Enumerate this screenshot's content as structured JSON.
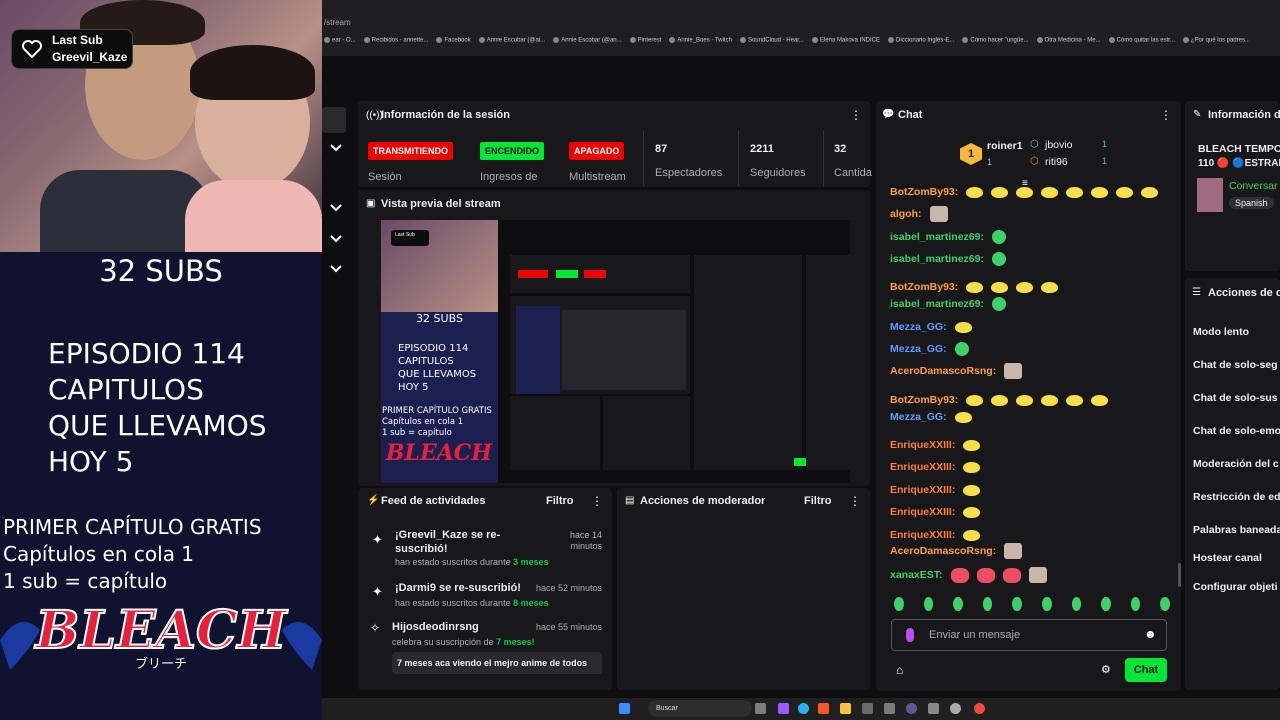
{
  "overlay": {
    "last_sub_title": "Last Sub",
    "last_sub_name": "Greevil_Kaze",
    "subs_count": "32 SUBS",
    "episode_lines": [
      "EPISODIO 114",
      "CAPITULOS",
      "QUE LLEVAMOS",
      "HOY 5"
    ],
    "free_lines": [
      "PRIMER CAPÍTULO GRATIS",
      "Capítulos en cola 1",
      "1 sub = capítulo"
    ],
    "logo_text": "BLEACH",
    "logo_sub": "ブリーチ"
  },
  "browser": {
    "url_fragment": "/stream",
    "bookmarks": [
      "ear - O...",
      "Recibidos - annette...",
      "Facebook",
      "Annie Escobar (@ai...",
      "Annie Escobar (@an...",
      "Pinterest",
      "Annie_Boes - Twitch",
      "SoundCloud - Hear...",
      "Elena Makova INDICE",
      "Diccionario Inglés-E...",
      "Cómo hacer \"ungüe...",
      "Otra Medicina - Me...",
      "Cómo quitar las estr...",
      "¿Por qué los padres..."
    ]
  },
  "session": {
    "title": "Información de la sesión",
    "badges": [
      {
        "label": "TRANSMITIENDO",
        "sub": "Sesión",
        "color": "#eb0400"
      },
      {
        "label": "ENCENDIDO",
        "sub": "Ingresos de",
        "color": "#00e639"
      },
      {
        "label": "APAGADO",
        "sub": "Multistream",
        "color": "#eb0400"
      }
    ],
    "stats": [
      {
        "value": "87",
        "label": "Espectadores"
      },
      {
        "value": "2211",
        "label": "Seguidores"
      },
      {
        "value": "32",
        "label": "Cantida"
      }
    ]
  },
  "preview": {
    "title": "Vista previa del stream"
  },
  "feed": {
    "title": "Feed de actividades",
    "filter": "Filtro",
    "items": [
      {
        "title": "¡Greevil_Kaze se re-suscribió!",
        "sub_pre": "han estado suscritos durante ",
        "sub_num": "3 meses",
        "time": "hace 14 minutos"
      },
      {
        "title": "¡Darmi9 se re-suscribió!",
        "sub_pre": "han estado suscritos durante ",
        "sub_num": "8 meses",
        "time": "hace 52 minutos"
      },
      {
        "title": "Hijosdeodinrsng",
        "sub_pre": "celebra su suscripción de ",
        "sub_num": "7 meses!",
        "time": "hace 55 minutos",
        "message": "7 meses aca viendo el mejro anime de todos"
      }
    ]
  },
  "moderator": {
    "title": "Acciones de moderador",
    "filter": "Filtro"
  },
  "chat": {
    "title": "Chat",
    "leaders": [
      {
        "name": "roiner1",
        "score": "1"
      },
      {
        "name": "jbovio",
        "score": "1"
      },
      {
        "name": "riti96",
        "score": "1"
      }
    ],
    "messages": [
      {
        "user": "BotZomBy93:",
        "color": "#ff9f3a",
        "emotes": "yyyyyyyy"
      },
      {
        "user": "algoh:",
        "color": "#ff9f3a",
        "emotes": "c"
      },
      {
        "user": "isabel_martinez69:",
        "color": "#3ed16a",
        "emotes": "g"
      },
      {
        "user": "isabel_martinez69:",
        "color": "#3ed16a",
        "emotes": "g"
      },
      {
        "user": "BotZomBy93:",
        "color": "#ff9f3a",
        "emotes": "yyyy"
      },
      {
        "user": "isabel_martinez69:",
        "color": "#3ed16a",
        "emotes": "g"
      },
      {
        "user": "Mezza_GG:",
        "color": "#5c9dff",
        "emotes": "y"
      },
      {
        "user": "Mezza_GG:",
        "color": "#5c9dff",
        "emotes": "g"
      },
      {
        "user": "AceroDamascoRsng:",
        "color": "#ff9f3a",
        "emotes": "c"
      },
      {
        "user": "BotZomBy93:",
        "color": "#ff9f3a",
        "emotes": "yyyyyy"
      },
      {
        "user": "Mezza_GG:",
        "color": "#5c9dff",
        "emotes": "y"
      },
      {
        "user": "EnriqueXXIII:",
        "color": "#ff7f3a",
        "emotes": "y"
      },
      {
        "user": "EnriqueXXIII:",
        "color": "#ff7f3a",
        "emotes": "y"
      },
      {
        "user": "EnriqueXXIII:",
        "color": "#ff7f3a",
        "emotes": "y"
      },
      {
        "user": "EnriqueXXIII:",
        "color": "#ff7f3a",
        "emotes": "y"
      },
      {
        "user": "EnriqueXXIII:",
        "color": "#ff7f3a",
        "emotes": "y"
      },
      {
        "user": "AceroDamascoRsng:",
        "color": "#ff9f3a",
        "emotes": "c"
      },
      {
        "user": "xanaxEST:",
        "color": "#3ed16a",
        "emotes": "rrrc"
      }
    ],
    "input_placeholder": "Enviar un mensaje",
    "send_label": "Chat"
  },
  "info2": {
    "title": "Información de",
    "stream_title": "BLEACH TEMPO",
    "stream_title2": "110 🔴 🔵ESTRAL",
    "category": "Conversar",
    "language": "Spanish"
  },
  "actions": {
    "title": "Acciones de c",
    "items": [
      "Modo lento",
      "Chat de solo-seg",
      "Chat de solo-sus",
      "Chat de solo-emo",
      "Moderación del c",
      "Restricción de ed",
      "Palabras baneada",
      "Hostear canal",
      "Configurar objeti"
    ]
  },
  "taskbar": {
    "search_placeholder": "Buscar"
  }
}
